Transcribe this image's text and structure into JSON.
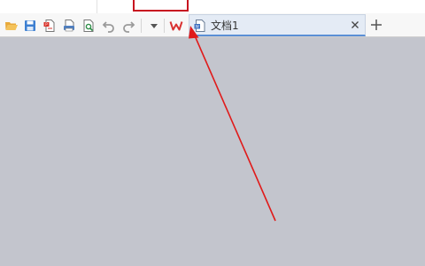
{
  "window": {
    "background": "#c3c5cd"
  },
  "toolbar": {
    "icons": [
      "open-folder-icon",
      "save-icon",
      "export-pdf-icon",
      "print-icon",
      "print-preview-icon",
      "undo-icon",
      "redo-icon",
      "dropdown-arrow-icon",
      "wps-logo-icon"
    ]
  },
  "tabs": [
    {
      "label": "文档1",
      "icon": "document-icon",
      "active": true
    }
  ],
  "annotation": {
    "color": "#e01b1b"
  }
}
